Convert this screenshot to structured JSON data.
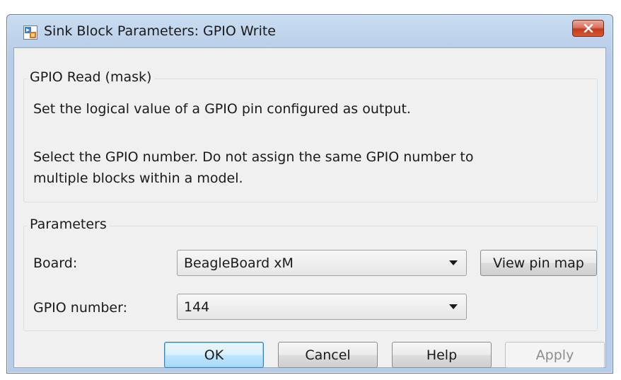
{
  "window": {
    "title": "Sink Block Parameters: GPIO Write",
    "icon": "simulink-block-icon",
    "close_icon": "close-icon"
  },
  "description_group": {
    "label": "GPIO Read (mask)",
    "line1": "Set the logical value of a GPIO pin configured as output.",
    "line2": "Select the GPIO number. Do not assign the same GPIO number to",
    "line3": "multiple blocks within a model."
  },
  "parameters_group": {
    "label": "Parameters",
    "board_label": "Board:",
    "board_value": "BeagleBoard xM",
    "view_pin_map_label": "View pin map",
    "gpio_label": "GPIO number:",
    "gpio_value": "144"
  },
  "buttons": {
    "ok": "OK",
    "cancel": "Cancel",
    "help": "Help",
    "apply": "Apply"
  }
}
